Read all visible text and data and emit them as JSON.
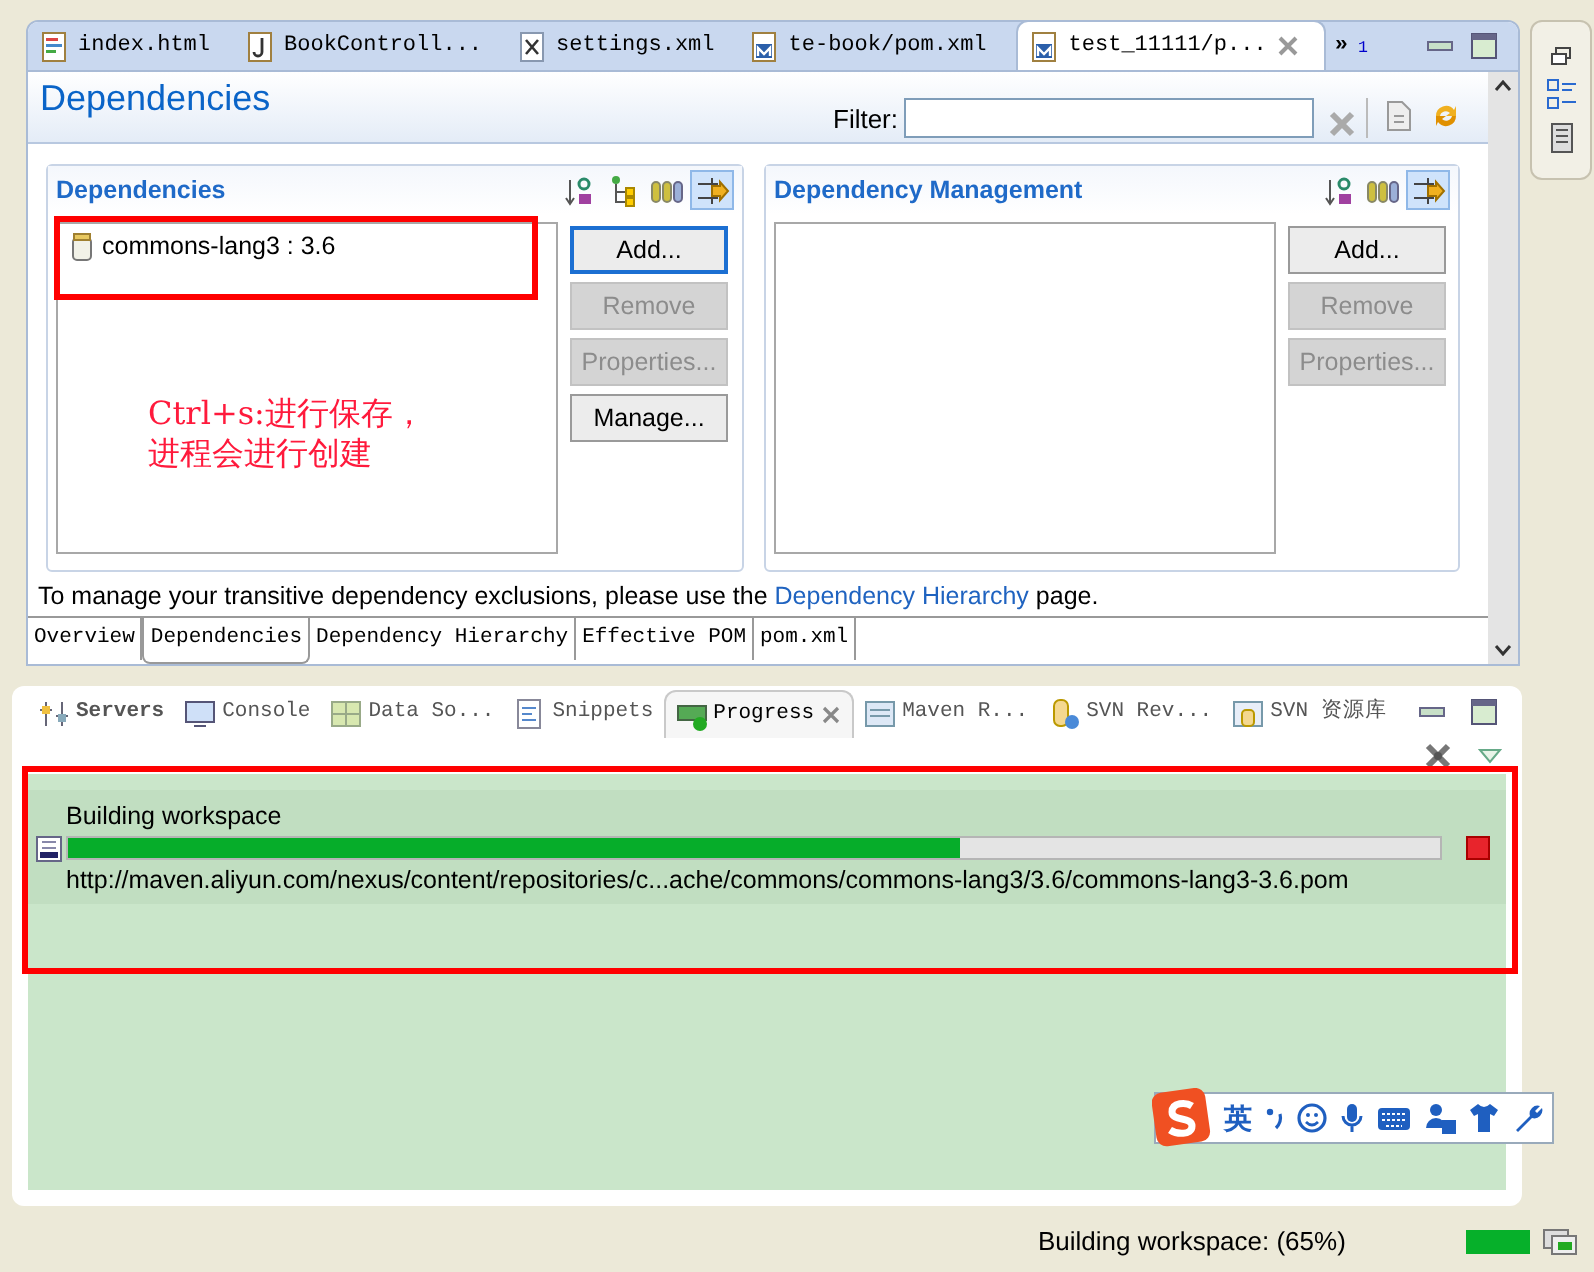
{
  "editor_tabs": [
    {
      "label": "index.html",
      "kind": "html",
      "selected": false
    },
    {
      "label": "BookControll...",
      "kind": "java",
      "selected": false
    },
    {
      "label": "settings.xml",
      "kind": "xml",
      "selected": false
    },
    {
      "label": "te-book/pom.xml",
      "kind": "maven",
      "selected": false
    },
    {
      "label": "test_11111/p...",
      "kind": "maven",
      "selected": true
    }
  ],
  "overflow": {
    "symbol": "»",
    "count": "1"
  },
  "form": {
    "title": "Dependencies",
    "filter_label": "Filter:"
  },
  "sections": [
    {
      "title": "Dependencies",
      "items": [
        {
          "label": "commons-lang3 : 3.6"
        }
      ],
      "tools": [
        {
          "kind": "sort"
        },
        {
          "kind": "tree"
        },
        {
          "kind": "columns"
        },
        {
          "kind": "filter"
        }
      ],
      "buttons": [
        {
          "label": "Add...",
          "disabled": false,
          "focused": true
        },
        {
          "label": "Remove",
          "disabled": true,
          "focused": false
        },
        {
          "label": "Properties...",
          "disabled": true,
          "focused": false
        },
        {
          "label": "Manage...",
          "disabled": false,
          "focused": false
        }
      ]
    },
    {
      "title": "Dependency Management",
      "tools": [
        {
          "kind": "sort"
        },
        {
          "kind": "columns"
        },
        {
          "kind": "filter"
        }
      ],
      "buttons": [
        {
          "label": "Add...",
          "disabled": false,
          "focused": false
        },
        {
          "label": "Remove",
          "disabled": true,
          "focused": false
        },
        {
          "label": "Properties...",
          "disabled": true,
          "focused": false
        }
      ]
    }
  ],
  "annotation": {
    "lines": [
      "Ctrl+s:进行保存，",
      "进程会进行创建"
    ]
  },
  "hint": {
    "before": "To manage your transitive dependency exclusions, please use the ",
    "link": "Dependency Hierarchy",
    "after": " page."
  },
  "page_tabs": [
    {
      "label": "Overview",
      "selected": false
    },
    {
      "label": "Dependencies",
      "selected": true
    },
    {
      "label": "Dependency Hierarchy",
      "selected": false
    },
    {
      "label": "Effective POM",
      "selected": false
    },
    {
      "label": "pom.xml",
      "selected": false
    }
  ],
  "view_tabs": [
    {
      "label": "Servers",
      "kind": "servers",
      "selected": false
    },
    {
      "label": "Console",
      "kind": "console",
      "selected": false
    },
    {
      "label": "Data So...",
      "kind": "data",
      "selected": false
    },
    {
      "label": "Snippets",
      "kind": "snippets",
      "selected": false
    },
    {
      "label": "Progress",
      "kind": "progress",
      "selected": true
    },
    {
      "label": "Maven R...",
      "kind": "maven",
      "selected": false
    },
    {
      "label": "SVN Rev...",
      "kind": "svn",
      "selected": false
    },
    {
      "label": "SVN 资源库",
      "kind": "repo",
      "selected": false
    }
  ],
  "progress": {
    "job": "Building workspace",
    "level": 0.65,
    "detail": "http://maven.aliyun.com/nexus/content/repositories/c...ache/commons/commons-lang3/3.6/commons-lang3-3.6.pom"
  },
  "ime": {
    "mode": "英"
  },
  "status": {
    "text": "Building workspace: (65%)"
  }
}
